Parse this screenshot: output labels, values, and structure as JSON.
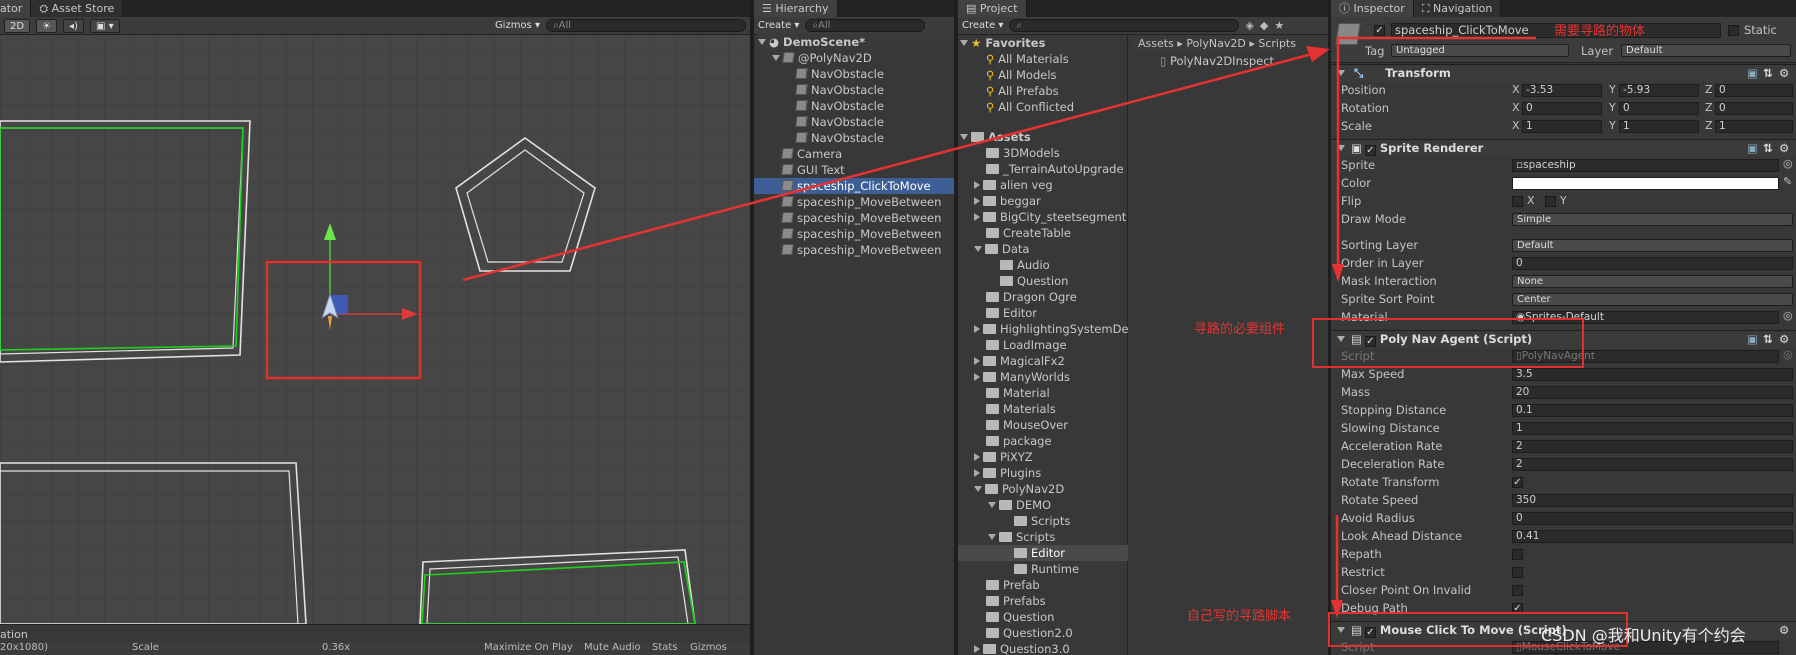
{
  "scene": {
    "tab_partial": "ator",
    "asset_store_tab": "Asset Store",
    "toolbar": {
      "mode_2d": "2D",
      "gizmos": "Gizmos",
      "search_placeholder": "All"
    },
    "bottom_tab_partial": "ation",
    "bottom_bar": {
      "resolution_partial": "20x1080)",
      "scale_label": "Scale",
      "scale_value": "0.36x",
      "maximize": "Maximize On Play",
      "mute": "Mute Audio",
      "stats": "Stats",
      "gizmos": "Gizmos"
    }
  },
  "hierarchy": {
    "tab": "Hierarchy",
    "create": "Create",
    "search_placeholder": "All",
    "scene_name": "DemoScene*",
    "items": [
      {
        "label": "@PolyNav2D"
      },
      {
        "label": "NavObstacle"
      },
      {
        "label": "NavObstacle"
      },
      {
        "label": "NavObstacle"
      },
      {
        "label": "NavObstacle"
      },
      {
        "label": "NavObstacle"
      },
      {
        "label": "Camera"
      },
      {
        "label": "GUI Text"
      },
      {
        "label": "spaceship_ClickToMove"
      },
      {
        "label": "spaceship_MoveBetween"
      },
      {
        "label": "spaceship_MoveBetween"
      },
      {
        "label": "spaceship_MoveBetween"
      },
      {
        "label": "spaceship_MoveBetween"
      }
    ]
  },
  "project": {
    "tab": "Project",
    "create": "Create",
    "favorites_title": "Favorites",
    "favorites": [
      "All Materials",
      "All Models",
      "All Prefabs",
      "All Conflicted"
    ],
    "assets_title": "Assets",
    "folders": [
      "3DModels",
      "_TerrainAutoUpgrade",
      "alien veg",
      "beggar",
      "BigCity_steetsegment",
      "CreateTable",
      "Data",
      "Audio",
      "Question",
      "Dragon Ogre",
      "Editor",
      "HighlightingSystemDe",
      "LoadImage",
      "MagicalFx2",
      "ManyWorlds",
      "Material",
      "Materials",
      "MouseOver",
      "package",
      "PiXYZ",
      "Plugins",
      "PolyNav2D",
      "DEMO",
      "Scripts",
      "Scripts",
      "Editor",
      "Runtime",
      "Prefab",
      "Prefabs",
      "Question",
      "Question2.0",
      "Question3.0"
    ],
    "breadcrumb": [
      "Assets",
      "PolyNav2D",
      "Scripts"
    ],
    "file": "PolyNav2DInspect"
  },
  "inspector": {
    "tab": "Inspector",
    "nav_tab": "Navigation",
    "object_name": "spaceship_ClickToMove",
    "static_label": "Static",
    "tag_label": "Tag",
    "tag_value": "Untagged",
    "layer_label": "Layer",
    "layer_value": "Default",
    "transform": {
      "title": "Transform",
      "position_label": "Position",
      "px": "-3.53",
      "py": "-5.93",
      "pz": "0",
      "rotation_label": "Rotation",
      "rx": "0",
      "ry": "0",
      "rz": "0",
      "scale_label": "Scale",
      "sx": "1",
      "sy": "1",
      "sz": "1"
    },
    "sprite_renderer": {
      "title": "Sprite Renderer",
      "sprite_label": "Sprite",
      "sprite_value": "spaceship",
      "color_label": "Color",
      "flip_label": "Flip",
      "flip_x": "X",
      "flip_y": "Y",
      "draw_mode_label": "Draw Mode",
      "draw_mode_value": "Simple",
      "sorting_layer_label": "Sorting Layer",
      "sorting_layer_value": "Default",
      "order_label": "Order in Layer",
      "order_value": "0",
      "mask_label": "Mask Interaction",
      "mask_value": "None",
      "sort_point_label": "Sprite Sort Point",
      "sort_point_value": "Center",
      "material_label": "Material",
      "material_value": "Sprites-Default"
    },
    "poly_nav_agent": {
      "title": "Poly Nav Agent (Script)",
      "script_label": "Script",
      "script_value": "PolyNavAgent",
      "fields": [
        {
          "label": "Max Speed",
          "value": "3.5"
        },
        {
          "label": "Mass",
          "value": "20"
        },
        {
          "label": "Stopping Distance",
          "value": "0.1"
        },
        {
          "label": "Slowing Distance",
          "value": "1"
        },
        {
          "label": "Acceleration Rate",
          "value": "2"
        },
        {
          "label": "Deceleration Rate",
          "value": "2"
        }
      ],
      "rotate_transform_label": "Rotate Transform",
      "fields2": [
        {
          "label": "Rotate Speed",
          "value": "350"
        },
        {
          "label": "Avoid Radius",
          "value": "0"
        },
        {
          "label": "Look Ahead Distance",
          "value": "0.41"
        }
      ],
      "repath_label": "Repath",
      "restrict_label": "Restrict",
      "closer_label": "Closer Point On Invalid",
      "debug_label": "Debug Path"
    },
    "mouse_click": {
      "title": "Mouse Click To Move (Script)",
      "script_label": "Script",
      "script_value": "MouseClickToMove"
    }
  },
  "annotations": {
    "object_note": "需要寻路的物体",
    "component_note": "寻路的必要组件",
    "script_note": "自己写的寻路脚本",
    "watermark": "CSDN @我和Unity有个约会"
  },
  "colors": {
    "selection": "#3e5f96",
    "annotation": "#e53232",
    "nav_green": "#1fd11f"
  }
}
